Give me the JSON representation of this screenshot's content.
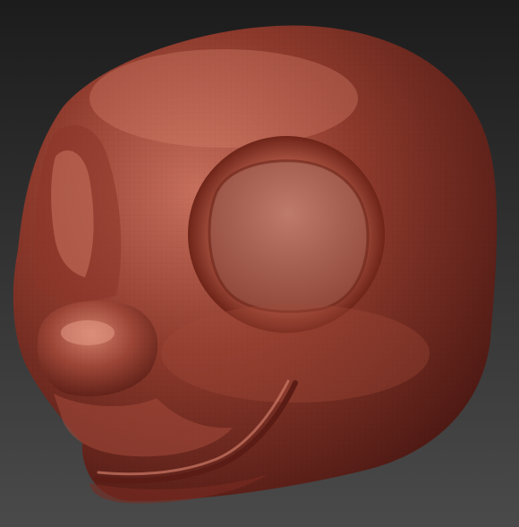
{
  "viewport": {
    "background_top": "#1c1c1c",
    "background_bottom": "#4a4a4a"
  },
  "model": {
    "subject": "sculpted-cartoon-animal-head",
    "material_base": "#8e3a2c",
    "material_light": "#c8705e",
    "material_shadow": "#4a1712",
    "eye_socket": "#b0685a",
    "mouth_line": "#5a1c15"
  }
}
